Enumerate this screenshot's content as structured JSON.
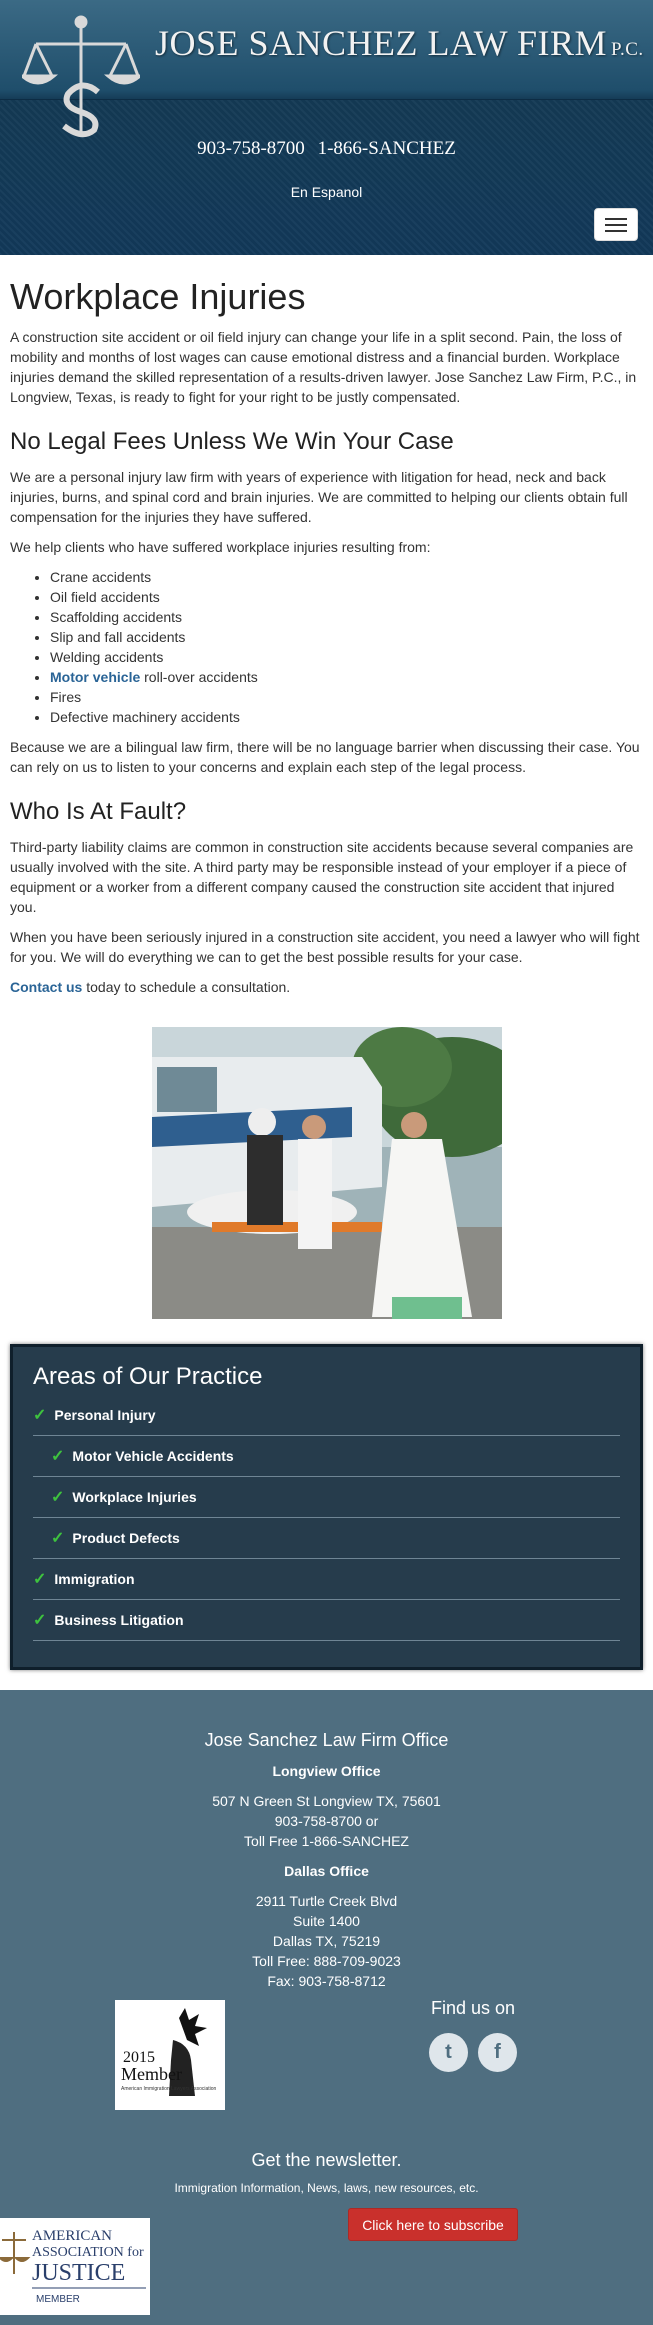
{
  "header": {
    "firm_name": "JOSE SANCHEZ LAW FIRM",
    "firm_suffix": "P.C.",
    "phone_1": "903-758-8700",
    "phone_2": "1-866-SANCHEZ",
    "espanol": "En Espanol"
  },
  "content": {
    "h1": "Workplace Injuries",
    "p1": "A construction site accident or oil field injury can change your life in a split second. Pain, the loss of mobility and months of lost wages can cause emotional distress and a financial burden. Workplace injuries demand the skilled representation of a results-driven lawyer. Jose Sanchez Law Firm, P.C., in Longview, Texas, is ready to fight for your right to be justly compensated.",
    "h2a": "No Legal Fees Unless We Win Your Case",
    "p2": "We are a personal injury law firm with years of experience with litigation for head, neck and back injuries, burns, and spinal cord and brain injuries. We are committed to helping our clients obtain full compensation for the injuries they have suffered.",
    "p3": "We help clients who have suffered workplace injuries resulting from:",
    "list": {
      "crane": "Crane accidents",
      "oil": "Oil field accidents",
      "scaffold": "Scaffolding accidents",
      "slip": "Slip and fall accidents",
      "weld": "Welding accidents",
      "motor_link": "Motor vehicle",
      "motor_rest": " roll-over accidents",
      "fires": "Fires",
      "machinery": "Defective machinery accidents"
    },
    "p4": "Because we are a bilingual law firm, there will be no language barrier when discussing their case. You can rely on us to listen to your concerns and explain each step of the legal process.",
    "h2b": "Who Is At Fault?",
    "p5": "Third-party liability claims are common in construction site accidents because several companies are usually involved with the site. A third party may be responsible instead of your employer if a piece of equipment or a worker from a different company caused the construction site accident that injured you.",
    "p6": "When you have been seriously injured in a construction site accident, you need a lawyer who will fight for you. We will do everything we can to get the best possible results for your case.",
    "contact_link": "Contact us",
    "contact_rest": " today to schedule a consultation."
  },
  "practice": {
    "title": "Areas of Our Practice",
    "items": [
      {
        "label": "Personal Injury"
      },
      {
        "label": "Motor Vehicle Accidents"
      },
      {
        "label": "Workplace Injuries"
      },
      {
        "label": "Product Defects"
      },
      {
        "label": "Immigration"
      },
      {
        "label": "Business Litigation"
      }
    ]
  },
  "footer": {
    "office_title": "Jose Sanchez Law Firm Office",
    "longview": {
      "name": "Longview Office",
      "line1": "507 N Green St Longview TX, 75601",
      "line2": "903-758-8700 or",
      "line3": "Toll Free 1-866-SANCHEZ"
    },
    "dallas": {
      "name": "Dallas Office",
      "line1": "2911 Turtle Creek Blvd",
      "line2": "Suite 1400",
      "line3": "Dallas TX, 75219",
      "line4": "Toll Free: 888-709-9023",
      "line5": "Fax: 903-758-8712"
    },
    "badge": {
      "year": "2015",
      "word": "Member",
      "org": "American Immigration Lawyers Association"
    },
    "find_us": "Find us on",
    "newsletter_title": "Get the newsletter.",
    "newsletter_sub": "Immigration Information, News, laws, new resources, etc.",
    "subscribe": "Click here to subscribe",
    "aaj": {
      "l1": "AMERICAN",
      "l2": "ASSOCIATION for",
      "l3": "JUSTICE",
      "l4": "MEMBER"
    }
  },
  "colors": {
    "accent": "#2a6496",
    "practice_bg": "#263c4c",
    "footer_bg": "#4f6e80",
    "check": "#3ec33e",
    "subscribe": "#c9302c"
  }
}
